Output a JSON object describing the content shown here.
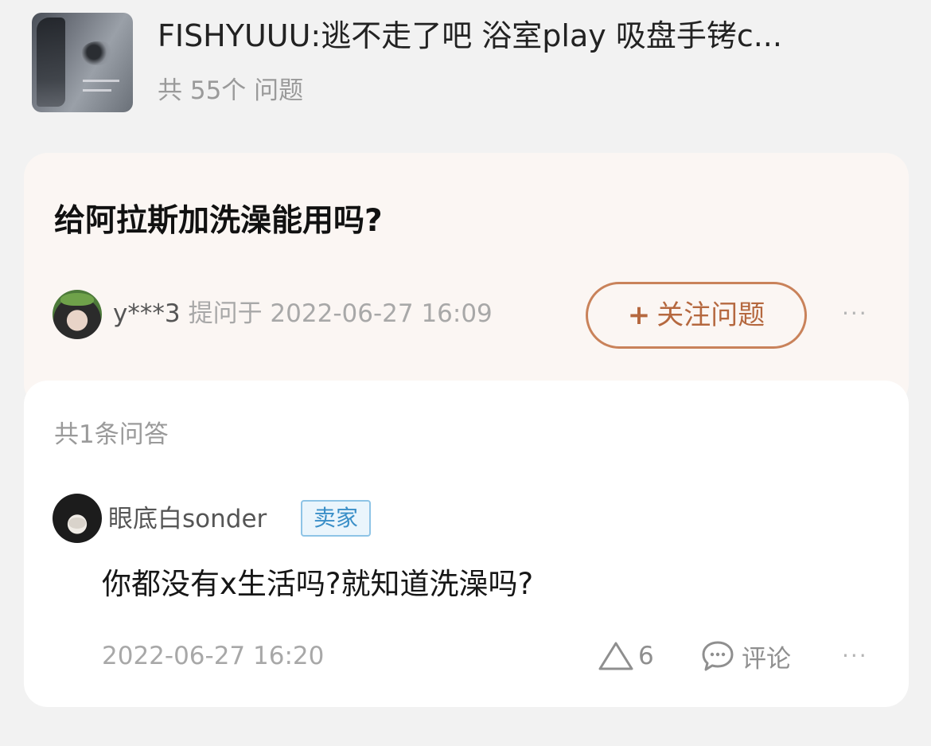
{
  "product": {
    "title": "FISHYUUU:逃不走了吧 浴室play 吸盘手铐c...",
    "question_count": "共 55个 问题"
  },
  "question": {
    "title": "给阿拉斯加洗澡能用吗?",
    "asker_name": "y***3",
    "asked_at": "提问于 2022-06-27 16:09",
    "follow_button": "关注问题",
    "follow_icon": "+",
    "more_icon": "···"
  },
  "answers": {
    "count_label": "共1条问答",
    "items": [
      {
        "author": "眼底白sonder",
        "badge": "卖家",
        "text": "你都没有x生活吗?就知道洗澡吗?",
        "time": "2022-06-27 16:20",
        "likes": "6",
        "comment_label": "评论",
        "more_icon": "···"
      }
    ]
  },
  "colors": {
    "accent": "#b5683f",
    "accent_border": "#c9825a",
    "question_bg": "#fbf6f3",
    "badge_blue": "#3a8fc8"
  }
}
